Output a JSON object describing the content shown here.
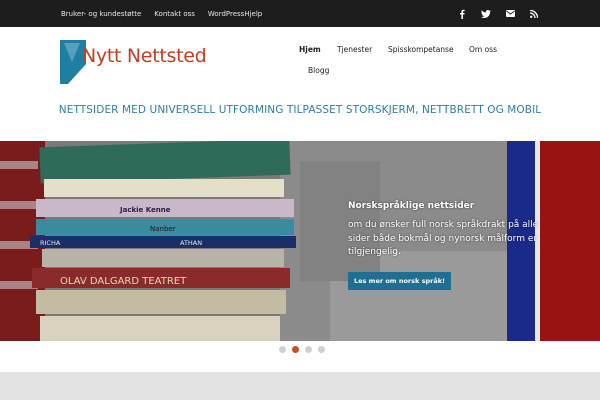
{
  "topbar": {
    "links": [
      "Bruker- og kundestøtte",
      "Kontakt oss",
      "WordPressHjelp"
    ],
    "social_icons": [
      "facebook-icon",
      "twitter-icon",
      "email-icon",
      "rss-icon"
    ]
  },
  "header": {
    "logo_text": "Nytt Nettsted",
    "nav": [
      "Hjem",
      "Tjenester",
      "Spisskompetanse",
      "Om oss",
      "Blogg"
    ],
    "active_nav": "Hjem"
  },
  "tagline": "NETTSIDER MED UNIVERSELL UTFORMING TILPASSET STORSKJERM, NETTBRETT OG MOBIL",
  "slider": {
    "title": "Norskspråklige nettsider",
    "text": "om du ønsker full norsk språkdrakt på alle sider både bokmål og nynorsk målform er tilgjengelig.",
    "button": "Les mer om norsk språk!",
    "dots": 4,
    "active_dot": 2,
    "book_titles": [
      "Jackie Kenne",
      "Nanber",
      "OLAV DALGARD TEATRET",
      "RICHA",
      "ATHAN"
    ]
  },
  "colors": {
    "topbar": "#1d1d1d",
    "logo_text": "#c53d1f",
    "tagline": "#2c7fa3",
    "button": "#1f6f93",
    "active_dot": "#d04a24"
  }
}
